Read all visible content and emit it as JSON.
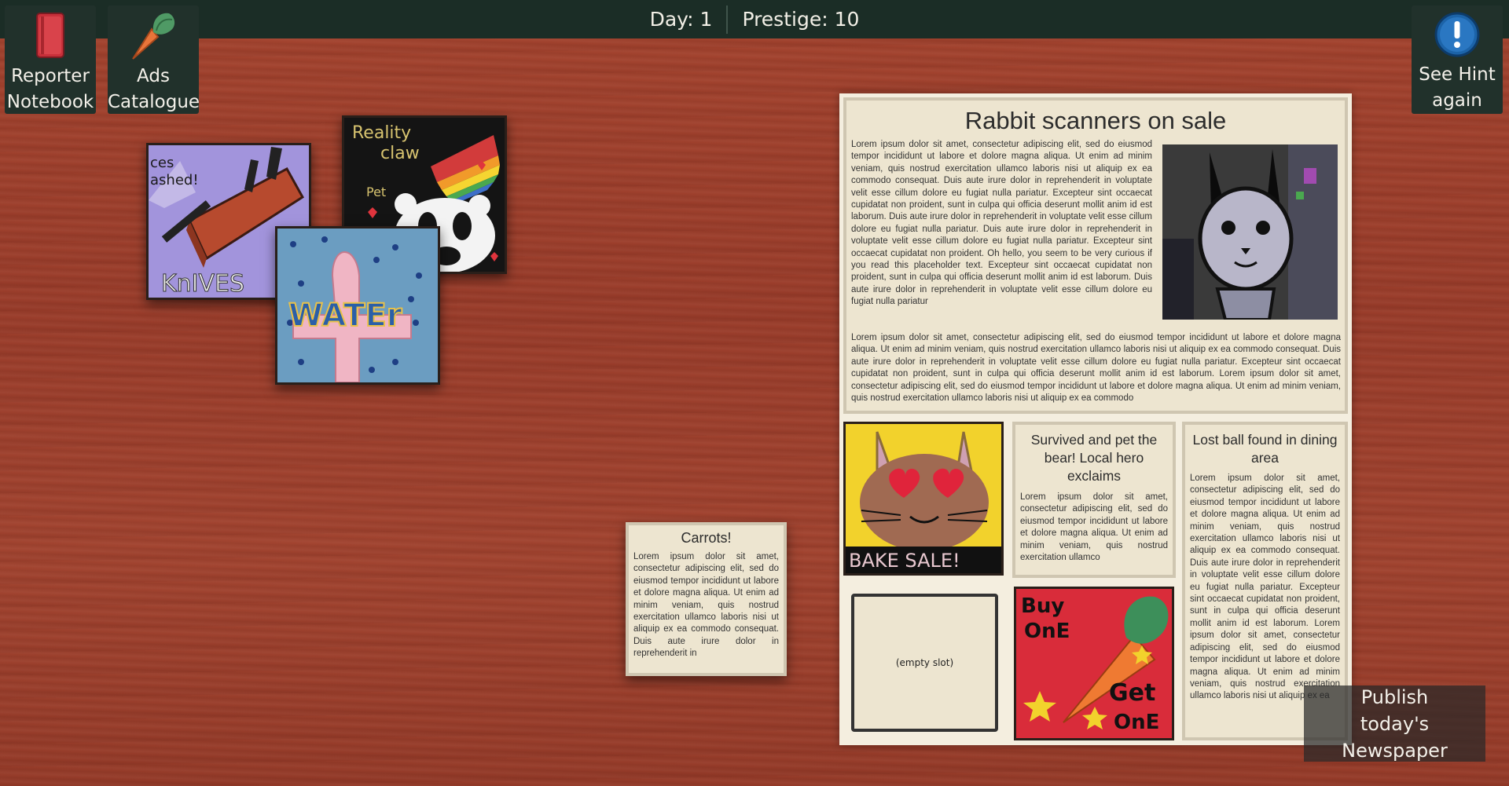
{
  "topbar": {
    "day": "Day: 1",
    "prestige": "Prestige: 10"
  },
  "buttons": {
    "reporter_notebook": [
      "Reporter",
      "Notebook"
    ],
    "ads_catalogue": [
      "Ads",
      "Catalogue"
    ],
    "see_hint": [
      "See Hint",
      "again"
    ],
    "publish": "Publish today's Newspaper"
  },
  "drawings": {
    "knives": {
      "top_text": "ces",
      "top_text2": "ashed!",
      "bottom_text": "KnIVES"
    },
    "reality_claw": {
      "line1": "Reality",
      "line2": "claw",
      "pet": "Pet"
    },
    "water": {
      "text": "WATEr"
    },
    "bake_sale": {
      "text": "BAKE SALE!"
    },
    "buy_one": {
      "line1": "Buy",
      "line2": "OnE",
      "line3": "Get",
      "line4": "OnE"
    }
  },
  "newspaper": {
    "main_headline": "Rabbit scanners on sale",
    "main_body_top": "Lorem ipsum dolor sit amet, consectetur adipiscing elit, sed do eiusmod tempor incididunt ut labore et dolore magna aliqua. Ut enim ad minim veniam, quis nostrud exercitation ullamco laboris nisi ut aliquip ex ea commodo consequat. Duis aute irure dolor in reprehenderit in voluptate velit esse cillum dolore eu fugiat nulla pariatur. Excepteur sint occaecat cupidatat non proident, sunt in culpa qui officia deserunt mollit anim id est laborum. Duis aute irure dolor in reprehenderit in voluptate velit esse cillum dolore eu fugiat nulla pariatur. Duis aute irure dolor in reprehenderit in voluptate velit esse cillum dolore eu fugiat nulla pariatur. Excepteur sint occaecat cupidatat non proident. Oh hello, you seem to be very curious if you read this placeholder text. Excepteur sint occaecat cupidatat non proident, sunt in culpa qui officia deserunt mollit anim id est laborum. Duis aute irure dolor in reprehenderit in voluptate velit esse cillum dolore eu fugiat nulla pariatur",
    "main_body_bottom": "Lorem ipsum dolor sit amet, consectetur adipiscing elit, sed do eiusmod tempor incididunt ut labore et dolore magna aliqua. Ut enim ad minim veniam, quis nostrud exercitation ullamco laboris nisi ut aliquip ex ea commodo consequat. Duis aute irure dolor in reprehenderit in voluptate velit esse cillum dolore eu fugiat nulla pariatur. Excepteur sint occaecat cupidatat non proident, sunt in culpa qui officia deserunt mollit anim id est laborum. Lorem ipsum dolor sit amet, consectetur adipiscing elit, sed do eiusmod tempor incididunt ut labore et dolore magna aliqua. Ut enim ad minim veniam, quis nostrud exercitation ullamco laboris nisi ut aliquip ex ea commodo",
    "bear_headline": "Survived and pet the bear! Local hero exclaims",
    "bear_body": "Lorem ipsum dolor sit amet, consectetur adipiscing elit, sed do eiusmod tempor incididunt ut labore et dolore magna aliqua. Ut enim ad minim veniam, quis nostrud exercitation ullamco",
    "ball_headline": "Lost ball found in dining area",
    "ball_body": "Lorem ipsum dolor sit amet, consectetur adipiscing elit, sed do eiusmod tempor incididunt ut labore et dolore magna aliqua. Ut enim ad minim veniam, quis nostrud exercitation ullamco laboris nisi ut aliquip ex ea commodo consequat. Duis aute irure dolor in reprehenderit in voluptate velit esse cillum dolore eu fugiat nulla pariatur. Excepteur sint occaecat cupidatat non proident, sunt in culpa qui officia deserunt mollit anim id est laborum. Lorem ipsum dolor sit amet, consectetur adipiscing elit, sed do eiusmod tempor incididunt ut labore et dolore magna aliqua. Ut enim ad minim veniam, quis nostrud exercitation ullamco laboris nisi ut aliquip ex ea",
    "empty_slot": "(empty slot)"
  },
  "loose_story": {
    "headline": "Carrots!",
    "body": "Lorem ipsum dolor sit amet, consectetur adipiscing elit, sed do eiusmod tempor incididunt ut labore et dolore magna aliqua. Ut enim ad minim veniam, quis nostrud exercitation ullamco laboris nisi ut aliquip ex ea commodo consequat. Duis aute irure dolor in reprehenderit in"
  }
}
